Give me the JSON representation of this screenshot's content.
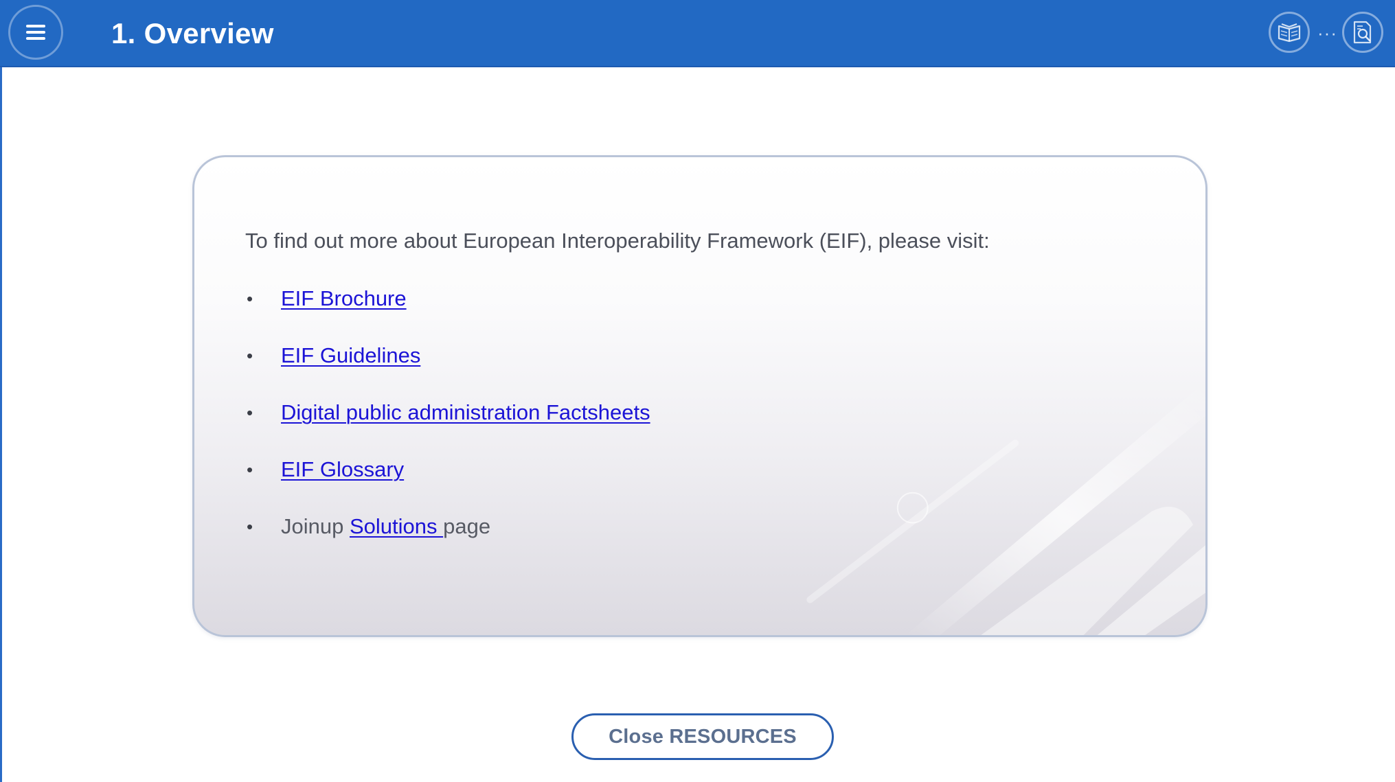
{
  "header": {
    "title": "1. Overview",
    "menu_icon": "hamburger-menu-icon",
    "book_icon": "book-icon",
    "dots": "···",
    "search_doc_icon": "document-search-icon",
    "background_color": "#2269c3"
  },
  "resources": {
    "intro": "To find out more about European Interoperability Framework (EIF), please visit:",
    "links": [
      {
        "label": "EIF Brochure"
      },
      {
        "label": "EIF Guidelines"
      },
      {
        "label": "Digital public administration Factsheets"
      },
      {
        "label": "EIF Glossary"
      }
    ],
    "joinup": {
      "prefix": "Joinup",
      "link": "Solutions ",
      "suffix": "page"
    },
    "bullet": "•"
  },
  "footer": {
    "close_label": "Close RESOURCES"
  },
  "colors": {
    "link": "#1b13d6",
    "accent": "#2a5fb0"
  }
}
